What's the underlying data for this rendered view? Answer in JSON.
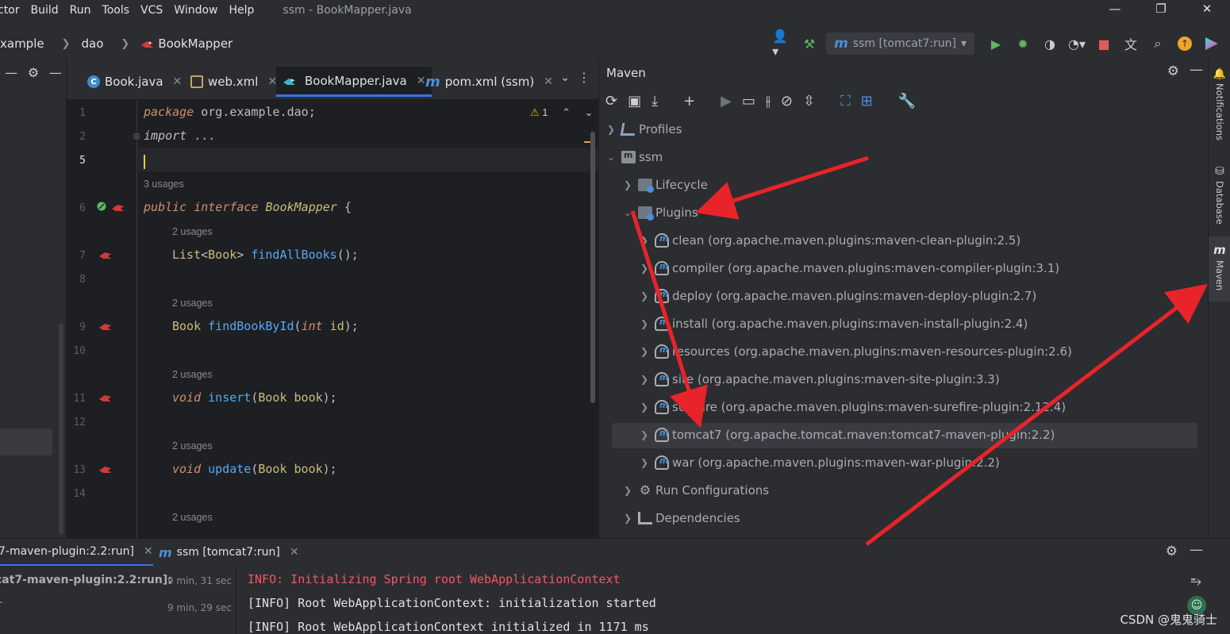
{
  "menubar": {
    "items": [
      "ctor",
      "Build",
      "Run",
      "Tools",
      "VCS",
      "Window",
      "Help"
    ],
    "title": "ssm - BookMapper.java"
  },
  "navbar": {
    "crumbs": [
      "xample",
      "dao",
      "BookMapper"
    ],
    "run_config": "ssm [tomcat7:run]"
  },
  "editor": {
    "tabs": [
      {
        "label": "Book.java"
      },
      {
        "label": "web.xml"
      },
      {
        "label": "BookMapper.java"
      },
      {
        "label": "pom.xml (ssm)"
      }
    ],
    "warning_count": "1",
    "line_numbers": [
      "1",
      "2",
      "5",
      "6",
      "7",
      "8",
      "9",
      "10",
      "11",
      "12",
      "13",
      "14"
    ],
    "lines": {
      "l1_kw": "package",
      "l1_rest": " org.example.dao;",
      "l2_kw": "import",
      "l2_rest": " ...",
      "usage_interface": "3 usages",
      "l6_kw1": "public",
      "l6_kw2": "interface",
      "l6_name": "BookMapper",
      "l6_brace": " {",
      "usage_1": "2 usages",
      "l7_type1": "List",
      "l7_lt": "<",
      "l7_type2": "Book",
      "l7_gt": "> ",
      "l7_fn": "findAllBooks",
      "l7_end": "();",
      "usage_2": "2 usages",
      "l9_type": "Book",
      "l9_fn": "findBookById",
      "l9_open": "(",
      "l9_kw": "int",
      "l9_param": " id",
      "l9_end": ");",
      "usage_3": "2 usages",
      "l11_kw": "void",
      "l11_fn": "insert",
      "l11_open": "(",
      "l11_type": "Book",
      "l11_param": " book",
      "l11_end": ");",
      "usage_4": "2 usages",
      "l13_kw": "void",
      "l13_fn": "update",
      "l13_open": "(",
      "l13_type": "Book",
      "l13_param": " book",
      "l13_end": ");",
      "usage_5": "2 usages"
    }
  },
  "maven": {
    "title": "Maven",
    "tree": {
      "profiles": "Profiles",
      "project": "ssm",
      "lifecycle": "Lifecycle",
      "plugins": "Plugins",
      "plugin_items": [
        "clean (org.apache.maven.plugins:maven-clean-plugin:2.5)",
        "compiler (org.apache.maven.plugins:maven-compiler-plugin:3.1)",
        "deploy (org.apache.maven.plugins:maven-deploy-plugin:2.7)",
        "install (org.apache.maven.plugins:maven-install-plugin:2.4)",
        "resources (org.apache.maven.plugins:maven-resources-plugin:2.6)",
        "site (org.apache.maven.plugins:maven-site-plugin:3.3)",
        "surefire (org.apache.maven.plugins:maven-surefire-plugin:2.12.4)",
        "tomcat7 (org.apache.tomcat.maven:tomcat7-maven-plugin:2.2)",
        "war (org.apache.maven.plugins:maven-war-plugin:2.2)"
      ],
      "run_configurations": "Run Configurations",
      "dependencies": "Dependencies"
    }
  },
  "right_stripe": {
    "notifications": "Notifications",
    "database": "Database",
    "maven": "Maven"
  },
  "run_panel": {
    "tabs": [
      "7-maven-plugin:2.2:run]",
      "ssm [tomcat7:run]"
    ],
    "tree": [
      {
        "label": "cat7-maven-plugin:2.2:run]:",
        "time": "9 min, 31 sec"
      },
      {
        "label": "T",
        "time": "9 min, 29 sec"
      }
    ],
    "console": [
      "INFO: Initializing Spring root WebApplicationContext",
      "[INFO] Root WebApplicationContext: initialization started",
      "[INFO] Root WebApplicationContext initialized in 1171 ms"
    ]
  },
  "watermark": "CSDN @鬼鬼骑士",
  "colors": {
    "accent": "#3574f0",
    "annotation_arrow": "#e8232a",
    "console_error": "#f75464"
  }
}
